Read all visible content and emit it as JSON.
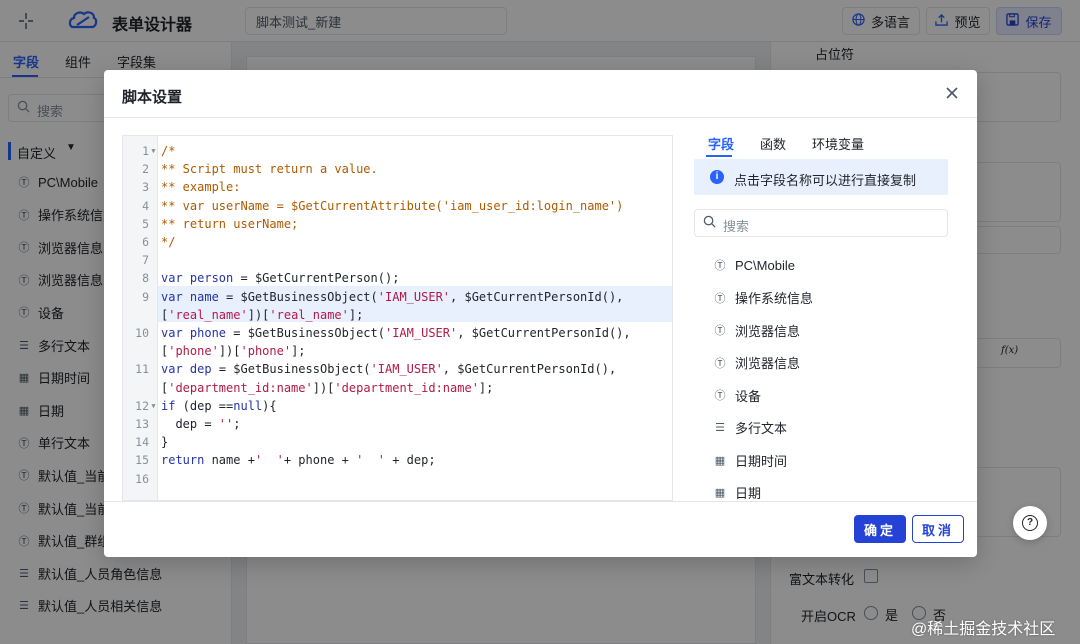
{
  "header": {
    "back_icon": "collapse-icon",
    "logo_icon": "cloud-logo-icon",
    "title": "表单设计器",
    "form_name_value": "脚本测试_新建",
    "lang_label": "多语言",
    "preview_label": "预览",
    "save_label": "保存",
    "accent_color": "#2962ff"
  },
  "left_panel": {
    "tabs": [
      "字段",
      "组件",
      "字段集"
    ],
    "search_placeholder": "搜索",
    "group_label": "自定义",
    "items": [
      {
        "icon": "attribute-icon",
        "label": "PC\\Mobile"
      },
      {
        "icon": "attribute-icon",
        "label": "操作系统信息"
      },
      {
        "icon": "attribute-icon",
        "label": "浏览器信息"
      },
      {
        "icon": "attribute-icon",
        "label": "浏览器信息"
      },
      {
        "icon": "attribute-icon",
        "label": "设备"
      },
      {
        "icon": "multiline-icon",
        "label": "多行文本"
      },
      {
        "icon": "calendar-icon",
        "label": "日期时间"
      },
      {
        "icon": "calendar-icon",
        "label": "日期"
      },
      {
        "icon": "attribute-icon",
        "label": "单行文本"
      },
      {
        "icon": "attribute-icon",
        "label": "默认值_当前"
      },
      {
        "icon": "attribute-icon",
        "label": "默认值_当前"
      },
      {
        "icon": "attribute-icon",
        "label": "默认值_群组"
      },
      {
        "icon": "multiline-icon",
        "label": "默认值_人员角色信息"
      },
      {
        "icon": "multiline-icon",
        "label": "默认值_人员相关信息"
      }
    ]
  },
  "right_panel": {
    "placeholder_label": "占位符",
    "rich_text_label": "富文本转化",
    "ocr_label": "开启OCR",
    "ocr_yes": "是",
    "ocr_no": "否",
    "fx_label": "f(x)"
  },
  "modal": {
    "title": "脚本设置",
    "close_icon": "close-icon",
    "code_lines": [
      {
        "n": "1",
        "fold": "▼",
        "tokens": [
          {
            "t": "/*",
            "c": "comment"
          }
        ]
      },
      {
        "n": "2",
        "fold": "",
        "tokens": [
          {
            "t": "** Script must return a value.",
            "c": "comment"
          }
        ]
      },
      {
        "n": "3",
        "fold": "",
        "tokens": [
          {
            "t": "** example:",
            "c": "comment"
          }
        ]
      },
      {
        "n": "4",
        "fold": "",
        "tokens": [
          {
            "t": "** var userName = $GetCurrentAttribute('iam_user_id:login_name')",
            "c": "comment"
          }
        ]
      },
      {
        "n": "5",
        "fold": "",
        "tokens": [
          {
            "t": "** return userName;",
            "c": "comment"
          }
        ]
      },
      {
        "n": "6",
        "fold": "",
        "tokens": [
          {
            "t": "*/",
            "c": "comment"
          }
        ]
      },
      {
        "n": "7",
        "fold": "",
        "tokens": []
      },
      {
        "n": "8",
        "fold": "",
        "tokens": [
          {
            "t": "var ",
            "c": "kw"
          },
          {
            "t": "person",
            "c": "kw"
          },
          {
            "t": " = $GetCurrentPerson();",
            "c": "fn"
          }
        ]
      },
      {
        "n": "9",
        "fold": "",
        "tokens": [
          {
            "t": "var ",
            "c": "kw"
          },
          {
            "t": "name",
            "c": "kw"
          },
          {
            "t": " = $GetBusinessObject(",
            "c": "fn"
          },
          {
            "t": "'IAM_USER'",
            "c": "str"
          },
          {
            "t": ", $GetCurrentPersonId(),",
            "c": "fn"
          }
        ]
      },
      {
        "n": "",
        "fold": "",
        "tokens": [
          {
            "t": "[",
            "c": "fn"
          },
          {
            "t": "'real_name'",
            "c": "str"
          },
          {
            "t": "])[",
            "c": "fn"
          },
          {
            "t": "'real_name'",
            "c": "str"
          },
          {
            "t": "];",
            "c": "fn"
          }
        ]
      },
      {
        "n": "10",
        "fold": "",
        "tokens": [
          {
            "t": "var ",
            "c": "kw"
          },
          {
            "t": "phone",
            "c": "kw"
          },
          {
            "t": " = $GetBusinessObject(",
            "c": "fn"
          },
          {
            "t": "'IAM_USER'",
            "c": "str"
          },
          {
            "t": ", $GetCurrentPersonId(),",
            "c": "fn"
          }
        ]
      },
      {
        "n": "",
        "fold": "",
        "tokens": [
          {
            "t": "[",
            "c": "fn"
          },
          {
            "t": "'phone'",
            "c": "str"
          },
          {
            "t": "])[",
            "c": "fn"
          },
          {
            "t": "'phone'",
            "c": "str"
          },
          {
            "t": "];",
            "c": "fn"
          }
        ]
      },
      {
        "n": "11",
        "fold": "",
        "tokens": [
          {
            "t": "var ",
            "c": "kw"
          },
          {
            "t": "dep",
            "c": "kw"
          },
          {
            "t": " = $GetBusinessObject(",
            "c": "fn"
          },
          {
            "t": "'IAM_USER'",
            "c": "str"
          },
          {
            "t": ", $GetCurrentPersonId(),",
            "c": "fn"
          }
        ]
      },
      {
        "n": "",
        "fold": "",
        "tokens": [
          {
            "t": "[",
            "c": "fn"
          },
          {
            "t": "'department_id:name'",
            "c": "str"
          },
          {
            "t": "])[",
            "c": "fn"
          },
          {
            "t": "'department_id:name'",
            "c": "str"
          },
          {
            "t": "];",
            "c": "fn"
          }
        ]
      },
      {
        "n": "12",
        "fold": "▼",
        "tokens": [
          {
            "t": "if",
            "c": "kw"
          },
          {
            "t": " (dep ==",
            "c": "fn"
          },
          {
            "t": "null",
            "c": "kw"
          },
          {
            "t": "){",
            "c": "fn"
          }
        ]
      },
      {
        "n": "13",
        "fold": "",
        "tokens": [
          {
            "t": "  dep = ",
            "c": "fn"
          },
          {
            "t": "''",
            "c": "str"
          },
          {
            "t": ";",
            "c": "fn"
          }
        ]
      },
      {
        "n": "14",
        "fold": "",
        "tokens": [
          {
            "t": "}",
            "c": "fn"
          }
        ]
      },
      {
        "n": "15",
        "fold": "",
        "tokens": [
          {
            "t": "return",
            "c": "kw"
          },
          {
            "t": " name +",
            "c": "fn"
          },
          {
            "t": "'  '",
            "c": "str"
          },
          {
            "t": "+ phone + ",
            "c": "fn"
          },
          {
            "t": "'  '",
            "c": "str"
          },
          {
            "t": " + dep;",
            "c": "fn"
          }
        ]
      },
      {
        "n": "16",
        "fold": "",
        "tokens": []
      }
    ],
    "side_tabs": [
      "字段",
      "函数",
      "环境变量"
    ],
    "info_text": "点击字段名称可以进行直接复制",
    "info_icon": "info-icon",
    "search_placeholder": "搜索",
    "fields": [
      {
        "icon": "attribute-icon",
        "label": "PC\\Mobile"
      },
      {
        "icon": "attribute-icon",
        "label": "操作系统信息"
      },
      {
        "icon": "attribute-icon",
        "label": "浏览器信息"
      },
      {
        "icon": "attribute-icon",
        "label": "浏览器信息"
      },
      {
        "icon": "attribute-icon",
        "label": "设备"
      },
      {
        "icon": "multiline-icon",
        "label": "多行文本"
      },
      {
        "icon": "calendar-icon",
        "label": "日期时间"
      },
      {
        "icon": "calendar-icon",
        "label": "日期"
      }
    ],
    "ok_label": "确定",
    "cancel_label": "取消",
    "primary_color": "#2443d6"
  },
  "help_icon": "help-icon",
  "credit_text": "@稀土掘金技术社区"
}
